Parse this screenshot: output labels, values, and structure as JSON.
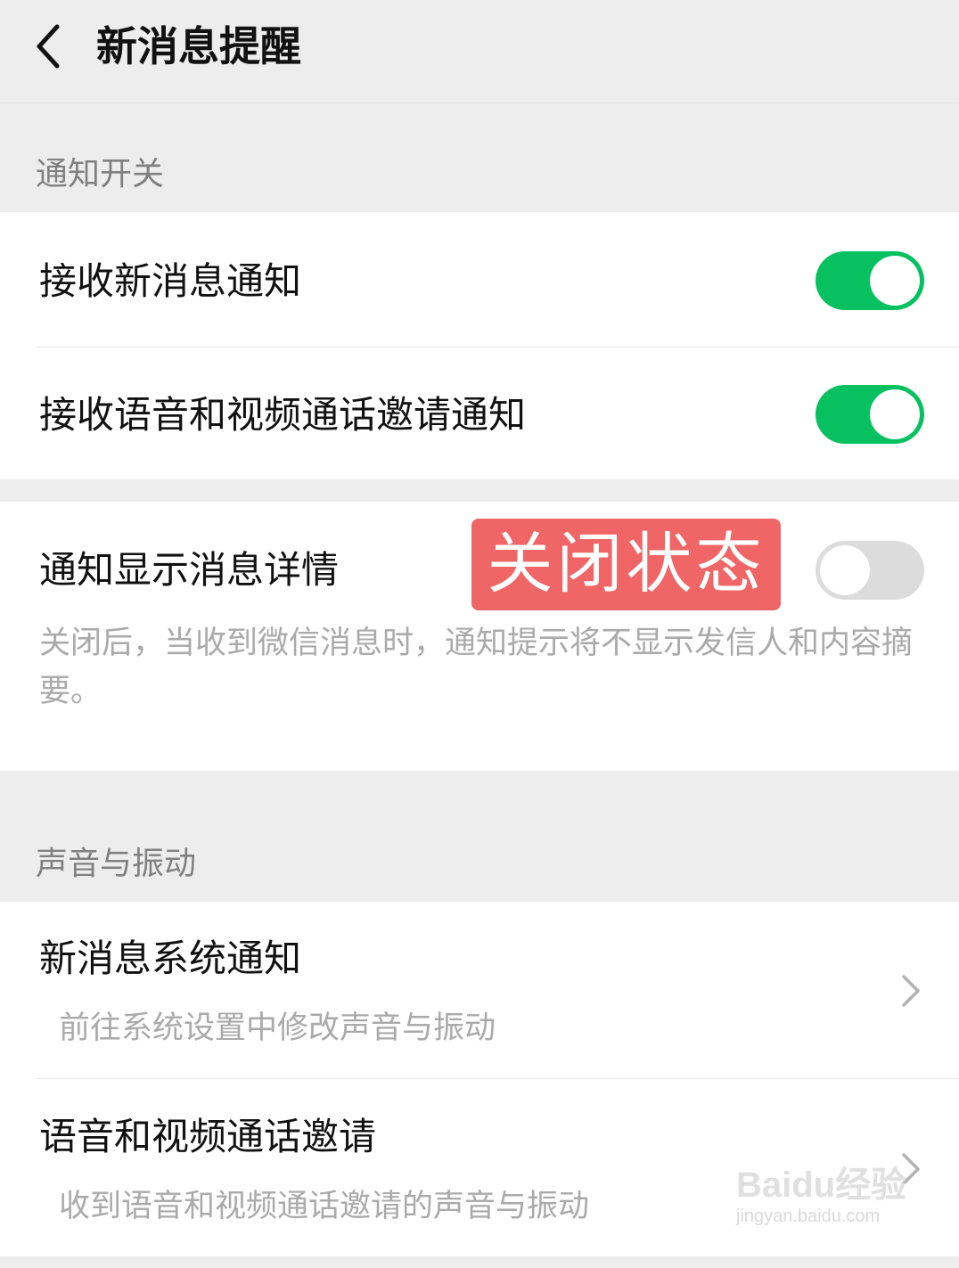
{
  "header": {
    "title": "新消息提醒"
  },
  "section_notify": {
    "label": "通知开关",
    "rows": [
      {
        "label": "接收新消息通知",
        "on": true
      },
      {
        "label": "接收语音和视频通话邀请通知",
        "on": true
      }
    ]
  },
  "detail": {
    "label": "通知显示消息详情",
    "on": false,
    "description": "关闭后，当收到微信消息时，通知提示将不显示发信人和内容摘要。",
    "badge": "关闭状态"
  },
  "section_sound": {
    "label": "声音与振动",
    "rows": [
      {
        "label": "新消息系统通知",
        "sub": "前往系统设置中修改声音与振动"
      },
      {
        "label": "语音和视频通话邀请",
        "sub": "收到语音和视频通话邀请的声音与振动"
      }
    ]
  },
  "watermark": {
    "main": "Baidu经验",
    "sub": "jingyan.baidu.com"
  },
  "colors": {
    "toggle_on": "#07c160",
    "toggle_off": "#dcdcdc",
    "badge": "#f06565",
    "background": "#ededed"
  }
}
